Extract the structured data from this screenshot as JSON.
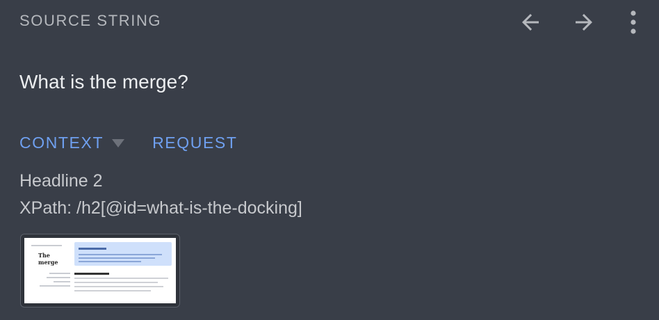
{
  "header": {
    "label": "SOURCE STRING"
  },
  "toolbar": {
    "back_icon": "arrow-left-icon",
    "forward_icon": "arrow-right-icon",
    "more_icon": "more-vert-icon"
  },
  "source": {
    "text": "What is the merge?"
  },
  "tabs": [
    {
      "label": "CONTEXT"
    },
    {
      "label": "REQUEST"
    }
  ],
  "context": {
    "element_type": "Headline 2",
    "xpath": "XPath: /h2[@id=what-is-the-docking]"
  },
  "screenshot": {
    "title": "The merge"
  },
  "colors": {
    "background": "#393e48",
    "accent": "#6fa0f0",
    "muted": "#b5b8bd"
  }
}
